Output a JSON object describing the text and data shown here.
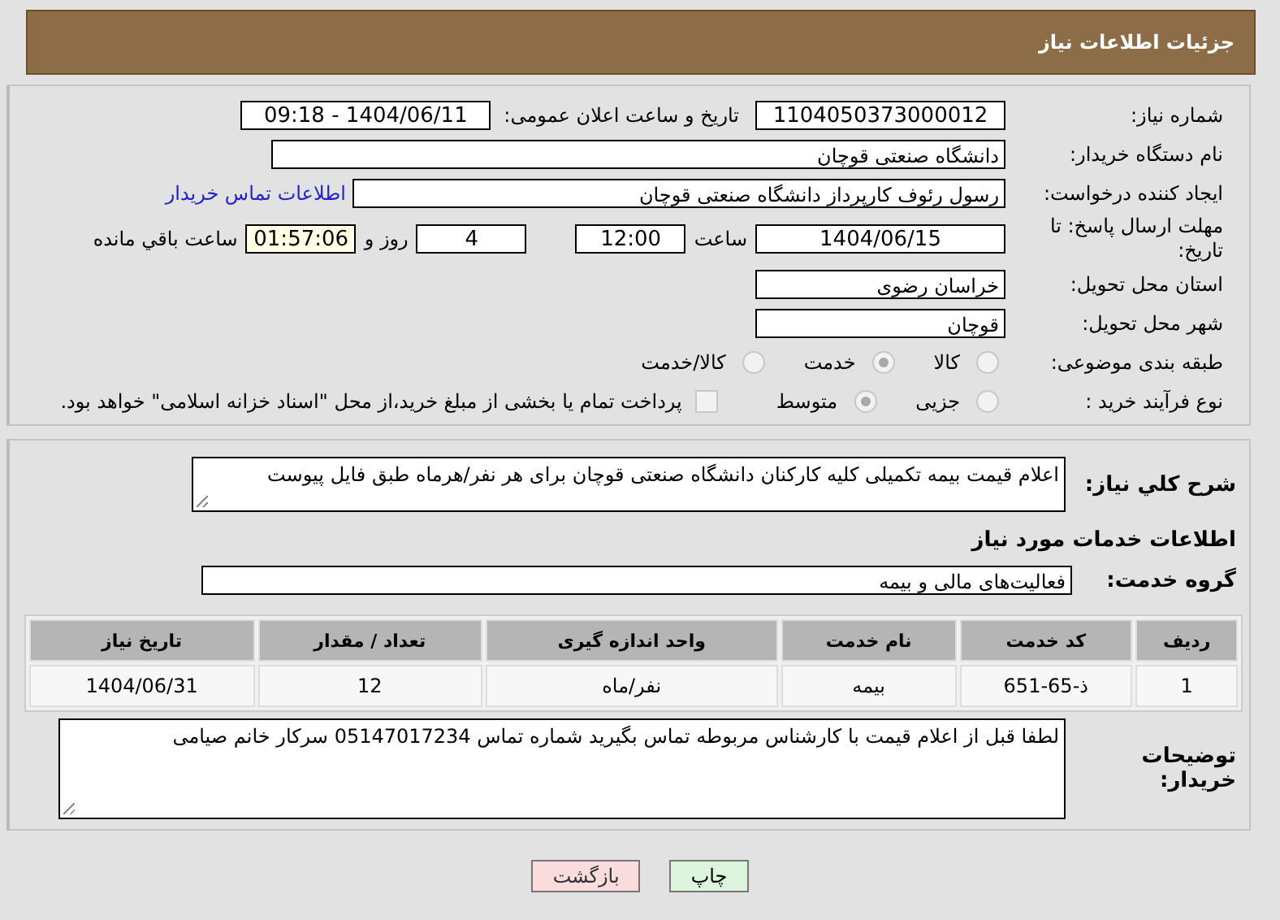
{
  "header": {
    "title": "جزئیات اطلاعات نیاز"
  },
  "details": {
    "need_number": {
      "label": "شماره نیاز:",
      "value": "1104050373000012"
    },
    "announce": {
      "label": "تاریخ و ساعت اعلان عمومی:",
      "value": "1404/06/11 - 09:18"
    },
    "buyer": {
      "label": "نام دستگاه خریدار:",
      "value": "دانشگاه صنعتی قوچان"
    },
    "creator": {
      "label": "ایجاد کننده درخواست:",
      "value": "رسول رئوف کارپرداز دانشگاه صنعتی قوچان",
      "link": "اطلاعات تماس خریدار"
    },
    "deadline": {
      "label": "مهلت ارسال پاسخ: تا تاریخ:",
      "date": "1404/06/15",
      "time_label": "ساعت",
      "time": "12:00",
      "days": "4",
      "days_label": "روز و",
      "remaining": "01:57:06",
      "remaining_label": "ساعت باقي مانده"
    },
    "province": {
      "label": "استان محل تحویل:",
      "value": "خراسان رضوی"
    },
    "city": {
      "label": "شهر محل تحویل:",
      "value": "قوچان"
    },
    "category": {
      "label": "طبقه بندی موضوعی:",
      "options": [
        {
          "label": "کالا",
          "selected": false
        },
        {
          "label": "خدمت",
          "selected": true
        },
        {
          "label": "کالا/خدمت",
          "selected": false
        }
      ]
    },
    "process": {
      "label": "نوع فرآیند خرید :",
      "options": [
        {
          "label": "جزیی",
          "selected": false
        },
        {
          "label": "متوسط",
          "selected": true
        }
      ],
      "payment": {
        "checked": false,
        "text": "پرداخت تمام یا بخشی از مبلغ خرید،از محل \"اسناد خزانه اسلامی\" خواهد بود."
      }
    }
  },
  "services": {
    "description": {
      "label": "شرح کلي نیاز:",
      "value": "اعلام قیمت بیمه تکمیلی کلیه کارکنان دانشگاه صنعتی قوچان برای هر نفر/هرماه طبق فایل پیوست"
    },
    "heading": "اطلاعات خدمات مورد نیاز",
    "group": {
      "label": "گروه خدمت:",
      "value": "فعالیت‌های مالی و بیمه"
    },
    "table": {
      "columns": [
        "ردیف",
        "کد خدمت",
        "نام خدمت",
        "واحد اندازه گیری",
        "تعداد / مقدار",
        "تاریخ نیاز"
      ],
      "rows": [
        [
          "1",
          "ذ-65-651",
          "بیمه",
          "نفر/ماه",
          "12",
          "1404/06/31"
        ]
      ]
    },
    "notes": {
      "label": "توضیحات خریدار:",
      "value": "لطفا قبل از اعلام قیمت با کارشناس مربوطه تماس بگیرید شماره تماس 05147017234 سرکار خانم صیامی"
    }
  },
  "buttons": [
    {
      "kind": "print",
      "label": "چاپ"
    },
    {
      "kind": "back",
      "label": "بازگشت"
    }
  ]
}
